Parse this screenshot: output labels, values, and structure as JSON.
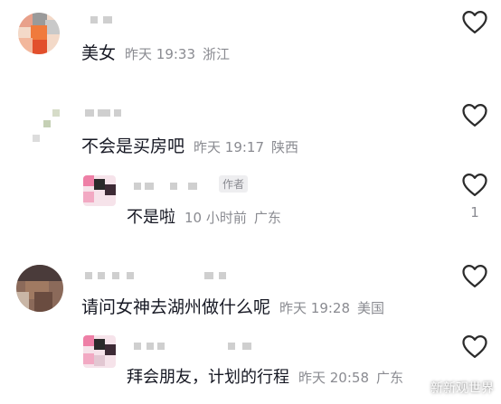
{
  "comments": [
    {
      "text": "美女",
      "time": "昨天 19:33",
      "location": "浙江"
    },
    {
      "text": "不会是买房吧",
      "time": "昨天 19:17",
      "location": "陕西"
    },
    {
      "text": "不是啦",
      "time": "10 小时前",
      "location": "广东",
      "badge": "作者",
      "likes": "1"
    },
    {
      "text": "请问女神去湖州做什么呢",
      "time": "昨天 19:28",
      "location": "美国"
    },
    {
      "text": "拜会朋友，计划的行程",
      "time": "昨天 20:58",
      "location": "广东"
    }
  ],
  "watermark": "新新观世界",
  "icons": {
    "like": "heart-icon",
    "watermark": "wechat-icon"
  },
  "colors": {
    "text": "#161823",
    "meta": "#8a8b91",
    "heart": "#2b2b2b"
  }
}
